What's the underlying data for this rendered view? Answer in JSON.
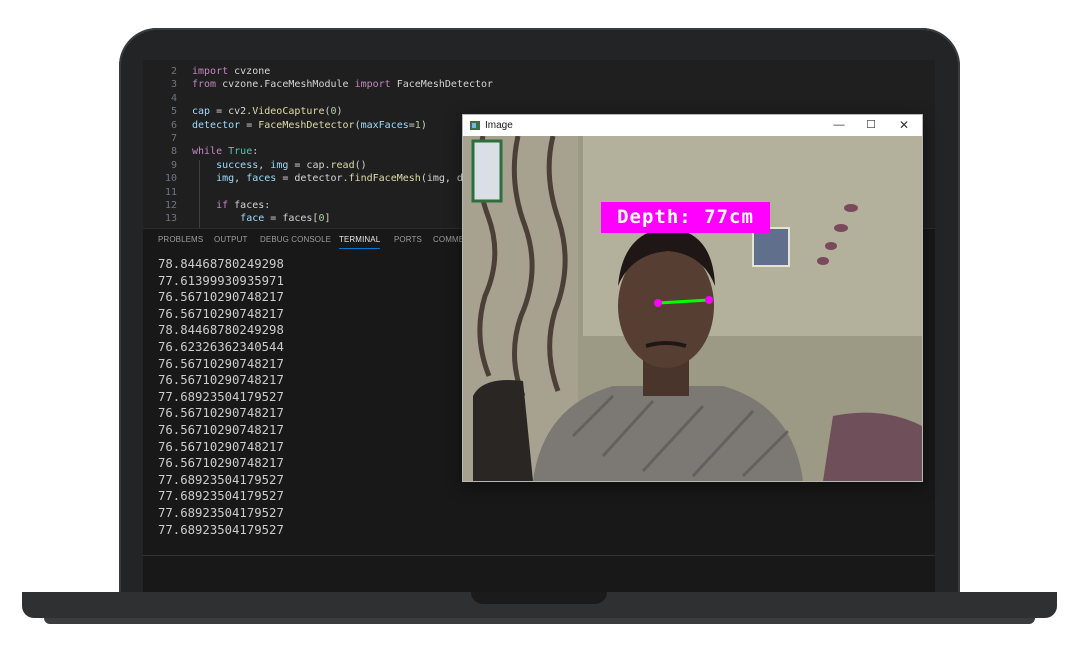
{
  "editor": {
    "lines": [
      {
        "n": "2",
        "parts": [
          [
            "kw",
            "import"
          ],
          [
            "txt",
            " cvzone"
          ]
        ]
      },
      {
        "n": "3",
        "parts": [
          [
            "kw",
            "from"
          ],
          [
            "txt",
            " cvzone.FaceMeshModule "
          ],
          [
            "kw",
            "import"
          ],
          [
            "txt",
            " FaceMeshDetector"
          ]
        ]
      },
      {
        "n": "4",
        "parts": []
      },
      {
        "n": "5",
        "parts": [
          [
            "var",
            "cap"
          ],
          [
            "txt",
            " = cv2."
          ],
          [
            "fn",
            "VideoCapture"
          ],
          [
            "txt",
            "("
          ],
          [
            "num",
            "0"
          ],
          [
            "txt",
            ")"
          ]
        ]
      },
      {
        "n": "6",
        "parts": [
          [
            "var",
            "detector"
          ],
          [
            "txt",
            " = "
          ],
          [
            "fn",
            "FaceMeshDetector"
          ],
          [
            "txt",
            "("
          ],
          [
            "var",
            "maxFaces"
          ],
          [
            "txt",
            "="
          ],
          [
            "num",
            "1"
          ],
          [
            "txt",
            ")"
          ]
        ]
      },
      {
        "n": "7",
        "parts": []
      },
      {
        "n": "8",
        "parts": [
          [
            "kw",
            "while"
          ],
          [
            "txt",
            " "
          ],
          [
            "mod",
            "True"
          ],
          [
            "txt",
            ":"
          ]
        ]
      },
      {
        "n": "9",
        "parts": [
          [
            "txt",
            "    "
          ],
          [
            "var",
            "success"
          ],
          [
            "txt",
            ", "
          ],
          [
            "var",
            "img"
          ],
          [
            "txt",
            " = cap."
          ],
          [
            "fn",
            "read"
          ],
          [
            "txt",
            "()"
          ]
        ]
      },
      {
        "n": "10",
        "parts": [
          [
            "txt",
            "    "
          ],
          [
            "var",
            "img"
          ],
          [
            "txt",
            ", "
          ],
          [
            "var",
            "faces"
          ],
          [
            "txt",
            " = detector."
          ],
          [
            "fn",
            "findFaceMesh"
          ],
          [
            "txt",
            "(img, draw="
          ]
        ]
      },
      {
        "n": "11",
        "parts": []
      },
      {
        "n": "12",
        "parts": [
          [
            "txt",
            "    "
          ],
          [
            "kw",
            "if"
          ],
          [
            "txt",
            " faces:"
          ]
        ]
      },
      {
        "n": "13",
        "parts": [
          [
            "txt",
            "        "
          ],
          [
            "var",
            "face"
          ],
          [
            "txt",
            " = faces["
          ],
          [
            "num",
            "0"
          ],
          [
            "txt",
            "]"
          ]
        ]
      }
    ]
  },
  "panel": {
    "tabs": [
      "PROBLEMS",
      "OUTPUT",
      "DEBUG CONSOLE",
      "TERMINAL",
      "PORTS",
      "COMME"
    ],
    "active_tab": "TERMINAL",
    "terminal_lines": [
      "78.84468780249298",
      "77.61399930935971",
      "76.56710290748217",
      "76.56710290748217",
      "78.84468780249298",
      "76.62326362340544",
      "76.56710290748217",
      "76.56710290748217",
      "77.68923504179527",
      "76.56710290748217",
      "76.56710290748217",
      "76.56710290748217",
      "76.56710290748217",
      "77.68923504179527",
      "77.68923504179527",
      "77.68923504179527",
      "77.68923504179527"
    ]
  },
  "image_window": {
    "title": "Image",
    "minimize": "—",
    "maximize": "☐",
    "close": "✕",
    "depth_label": "Depth: 77cm",
    "colors": {
      "label_bg": "#ff00ff",
      "eye_line": "#00ff00",
      "eye_point": "#ff00ff"
    }
  }
}
